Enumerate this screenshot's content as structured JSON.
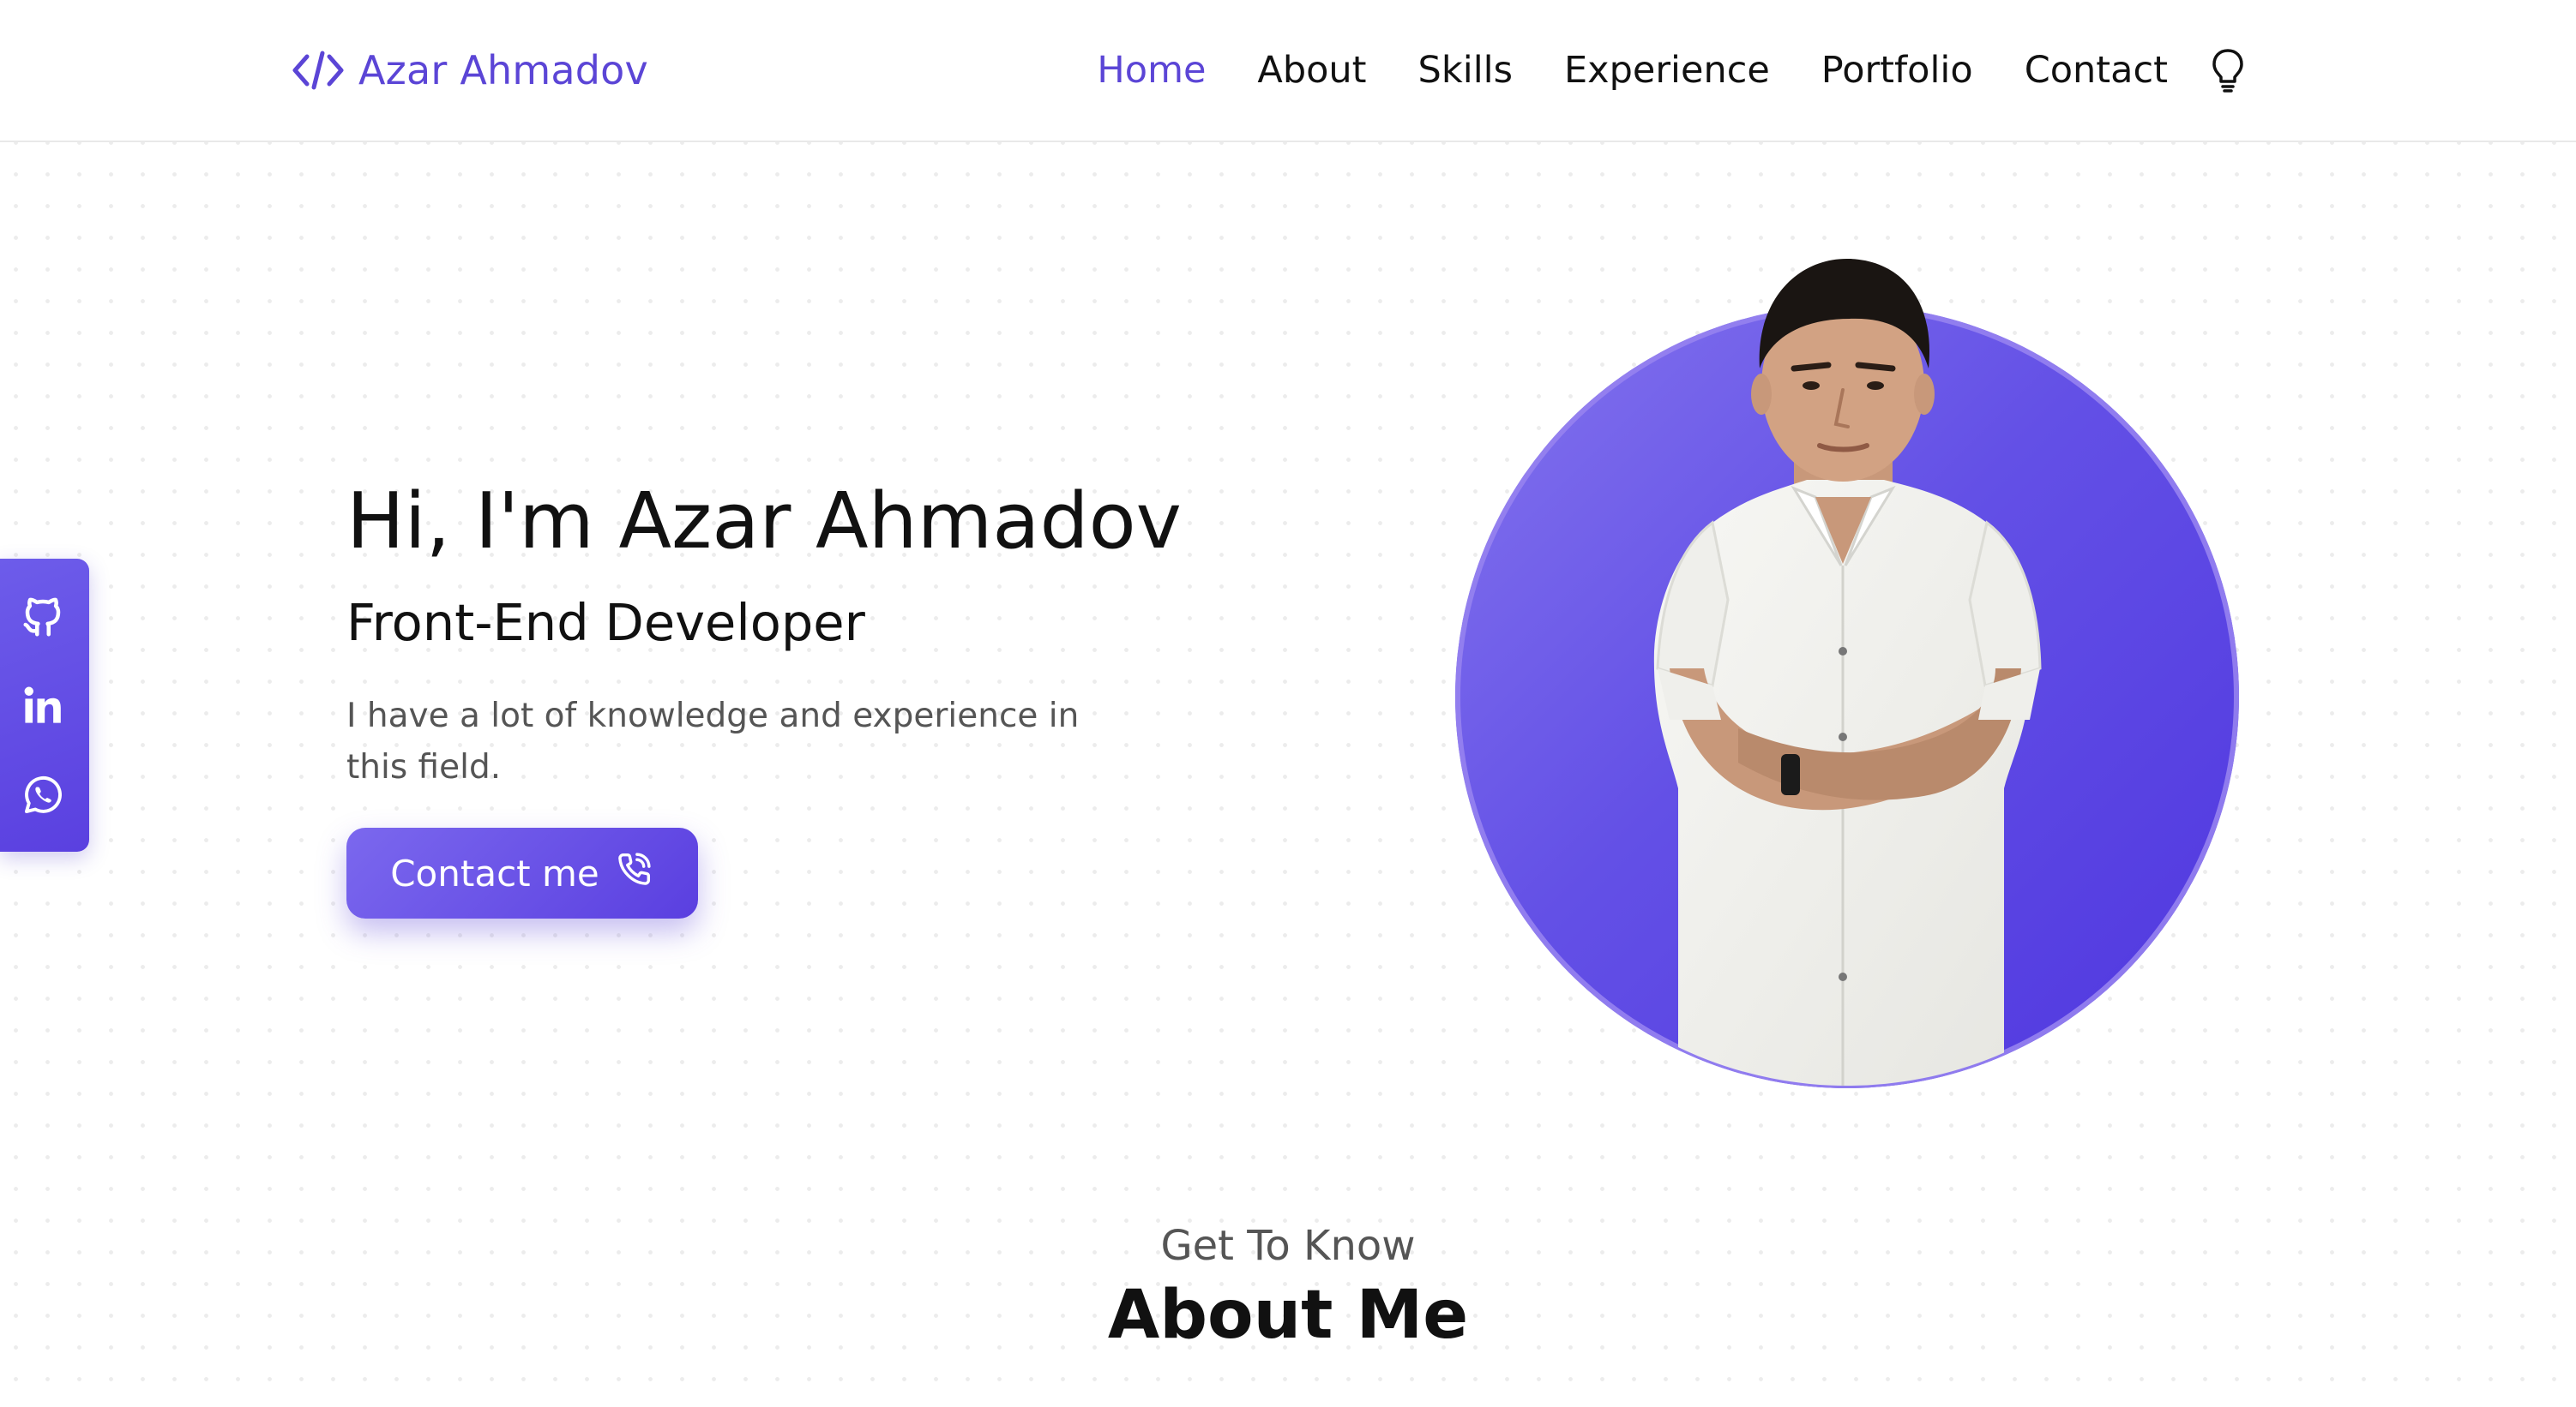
{
  "brand": {
    "logo_icon": "code-brackets-icon",
    "name": "Azar Ahmadov",
    "accent_color": "#5b45d6"
  },
  "nav": {
    "items": [
      {
        "label": "Home",
        "active": true
      },
      {
        "label": "About",
        "active": false
      },
      {
        "label": "Skills",
        "active": false
      },
      {
        "label": "Experience",
        "active": false
      },
      {
        "label": "Portfolio",
        "active": false
      },
      {
        "label": "Contact",
        "active": false
      }
    ],
    "theme_toggle_icon": "lightbulb-icon"
  },
  "social": {
    "icons": [
      "github-icon",
      "linkedin-icon",
      "whatsapp-icon"
    ]
  },
  "hero": {
    "title": "Hi, I'm Azar Ahmadov",
    "subtitle": "Front-End Developer",
    "description": "I have a lot of knowledge and experience in this field.",
    "cta_label": "Contact me",
    "cta_icon": "phone-icon",
    "portrait_circle_color": "#6a56e8"
  },
  "about": {
    "kicker": "Get To Know",
    "title": "About Me"
  }
}
